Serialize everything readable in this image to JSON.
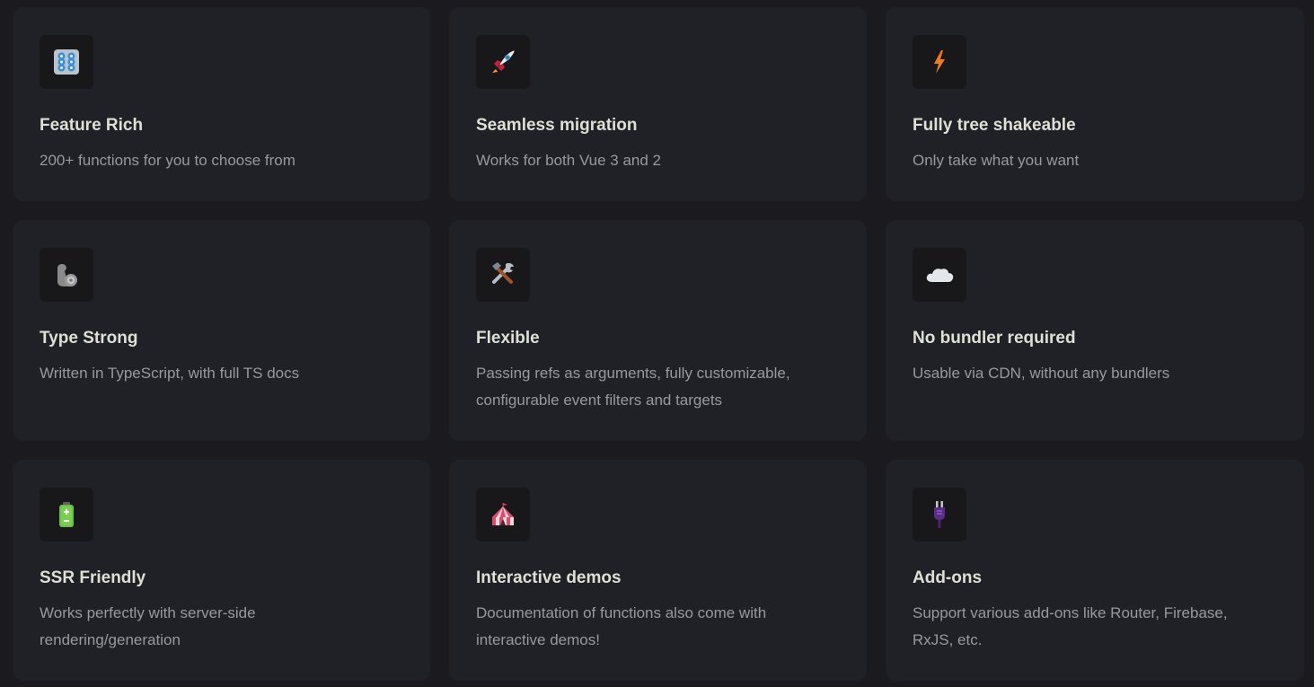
{
  "features": [
    {
      "icon": "control-knobs-icon",
      "title": "Feature Rich",
      "details": "200+ functions for you to choose from"
    },
    {
      "icon": "rocket-icon",
      "title": "Seamless migration",
      "details": "Works for both Vue 3 and 2"
    },
    {
      "icon": "high-voltage-icon",
      "title": "Fully tree shakeable",
      "details": "Only take what you want"
    },
    {
      "icon": "flexed-biceps-icon",
      "title": "Type Strong",
      "details": "Written in TypeScript, with full TS docs"
    },
    {
      "icon": "hammer-and-wrench-icon",
      "title": "Flexible",
      "details": "Passing refs as arguments, fully customizable, configurable event filters and targets"
    },
    {
      "icon": "cloud-icon",
      "title": "No bundler required",
      "details": "Usable via CDN, without any bundlers"
    },
    {
      "icon": "battery-icon",
      "title": "SSR Friendly",
      "details": "Works perfectly with server-side rendering/generation"
    },
    {
      "icon": "circus-tent-icon",
      "title": "Interactive demos",
      "details": "Documentation of functions also come with interactive demos!"
    },
    {
      "icon": "electric-plug-icon",
      "title": "Add-ons",
      "details": "Support various add-ons like Router, Firebase, RxJS, etc."
    }
  ]
}
